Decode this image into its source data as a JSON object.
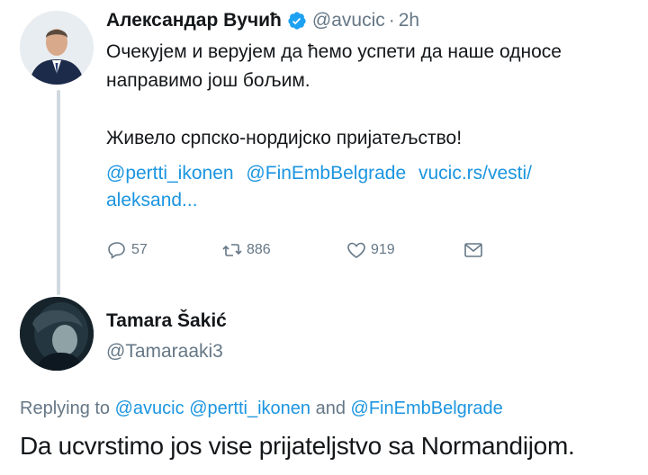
{
  "tweet1": {
    "display_name": "Александар Вучић",
    "handle": "@avucic",
    "separator": "·",
    "time": "2h",
    "body": "Очекујем и верујем да ћемо успети да наше односе\nнаправимо још бољим.\n\nЖивело српско-нордијско пријатељство!",
    "links": [
      "@pertti_ikonen",
      "@FinEmbBelgrade",
      "vucic.rs/vesti/",
      "aleksand..."
    ],
    "actions": {
      "reply_count": "57",
      "retweet_count": "886",
      "like_count": "919"
    }
  },
  "tweet2": {
    "display_name": "Tamara Šakić",
    "handle": "@Tamaraaki3",
    "replying_label": "Replying to",
    "replying_mentions": [
      "@avucic",
      "@pertti_ikonen",
      "@FinEmbBelgrade"
    ],
    "replying_conjunction": "and",
    "body": "Da ucvrstimo jos vise prijateljstvo sa Normandijom."
  },
  "colors": {
    "link": "#1b95e0",
    "muted": "#657786",
    "text": "#14171a",
    "thread_line": "#cfd9de"
  },
  "icons": [
    "verified-badge-icon",
    "reply-icon",
    "retweet-icon",
    "like-icon",
    "direct-message-icon"
  ]
}
